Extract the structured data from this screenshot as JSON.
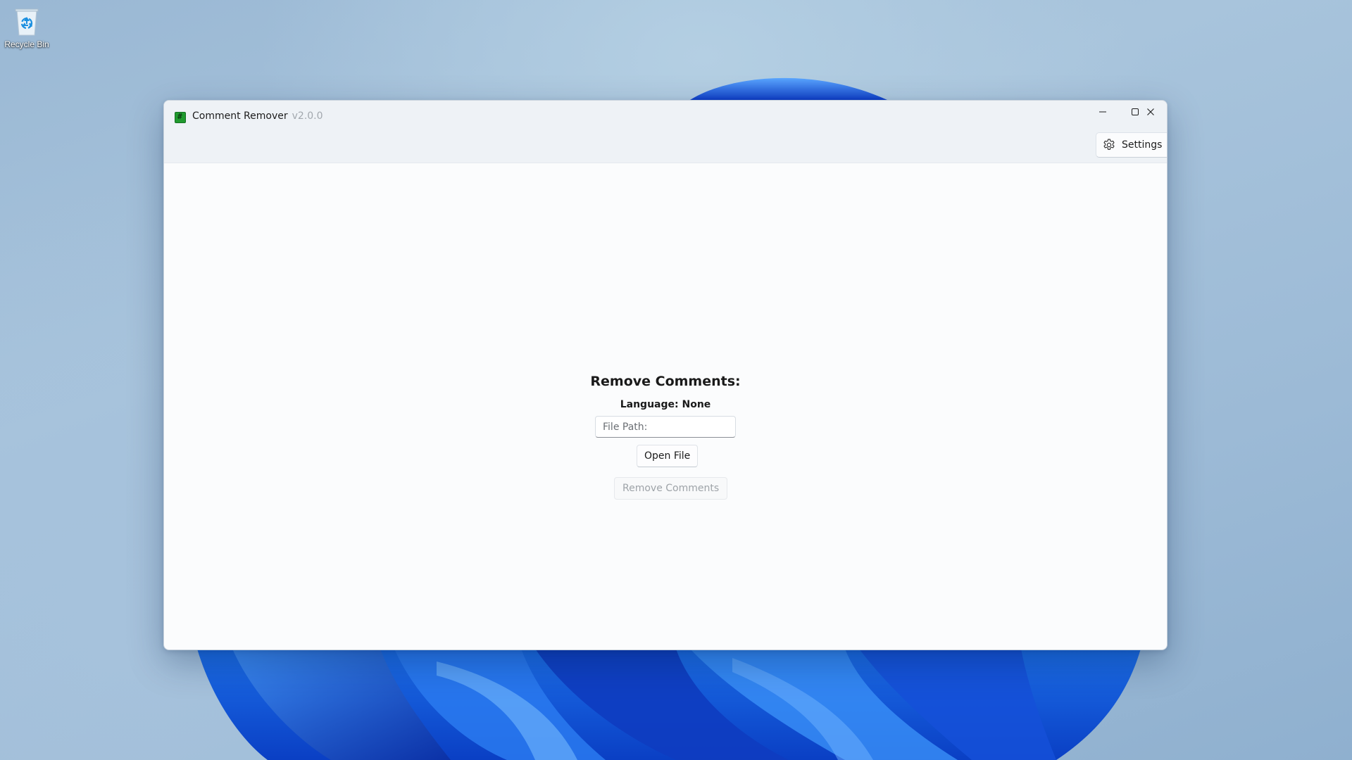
{
  "desktop": {
    "icons": [
      {
        "label": "Recycle Bin",
        "icon": "recycle-bin-icon"
      }
    ],
    "wallpaper": "windows-11-bloom"
  },
  "window": {
    "app_icon": "hash-app-icon",
    "title": "Comment Remover",
    "version": "v2.0.0",
    "caption_buttons": [
      "minimize-icon",
      "maximize-icon",
      "close-icon"
    ],
    "settings_label": "Settings",
    "settings_icon": "gear-icon"
  },
  "main": {
    "heading": "Remove Comments:",
    "language_label": "Language: None",
    "file_path": {
      "placeholder": "File Path:",
      "value": ""
    },
    "open_file_label": "Open File",
    "remove_comments_label": "Remove Comments",
    "remove_comments_enabled": false
  },
  "colors": {
    "accent_app_icon": "#1f9a2e",
    "titlebar": "#eef2f6",
    "content_bg": "#fbfcfd",
    "disabled_text": "#9ea3a8"
  }
}
